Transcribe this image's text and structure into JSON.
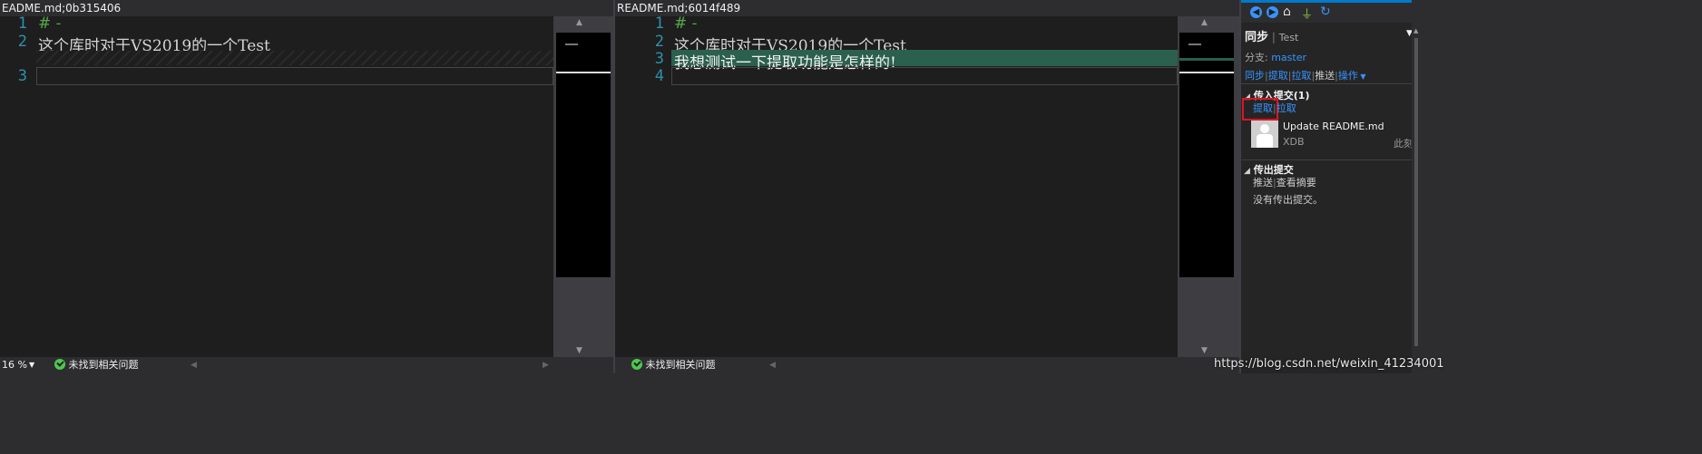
{
  "left": {
    "title": "EADME.md;0b315406",
    "lines": [
      {
        "num": "1",
        "text": "# -"
      },
      {
        "num": "2",
        "text": "这个库时对于VS2019的一个Test"
      },
      {
        "num": "3",
        "text": ""
      }
    ],
    "zoom": "16 %",
    "status_text": "未找到相关问题"
  },
  "right": {
    "title": "README.md;6014f489",
    "lines": [
      {
        "num": "1",
        "text": "# -"
      },
      {
        "num": "2",
        "text": "这个库时对于VS2019的一个Test"
      },
      {
        "num": "3",
        "text": "我想测试一下提取功能是怎样的!"
      },
      {
        "num": "4",
        "text": ""
      }
    ],
    "status_text": "未找到相关问题"
  },
  "team": {
    "nav_icons": [
      "back-icon",
      "forward-icon",
      "home-icon",
      "plug-icon",
      "refresh-icon"
    ],
    "title": "同步",
    "repo": "Test",
    "branch_label": "分支:",
    "branch": "master",
    "actions": [
      "同步",
      "提取",
      "拉取",
      "推送",
      "操作"
    ],
    "incoming": {
      "header": "传入提交(1)",
      "fetch": "提取",
      "pull": "拉取",
      "commit_title": "Update README.md",
      "commit_author": "XDB",
      "commit_time": "此刻"
    },
    "outgoing": {
      "header": "传出提交",
      "push": "推送",
      "view_summary": "查看摘要",
      "empty": "没有传出提交。"
    }
  },
  "watermark": "https://blog.csdn.net/weixin_41234001",
  "colors": {
    "added_line": "#2b5f4e",
    "link": "#3794ff",
    "highlight_box": "#e0141e",
    "line_numbers": "#2b91af"
  }
}
